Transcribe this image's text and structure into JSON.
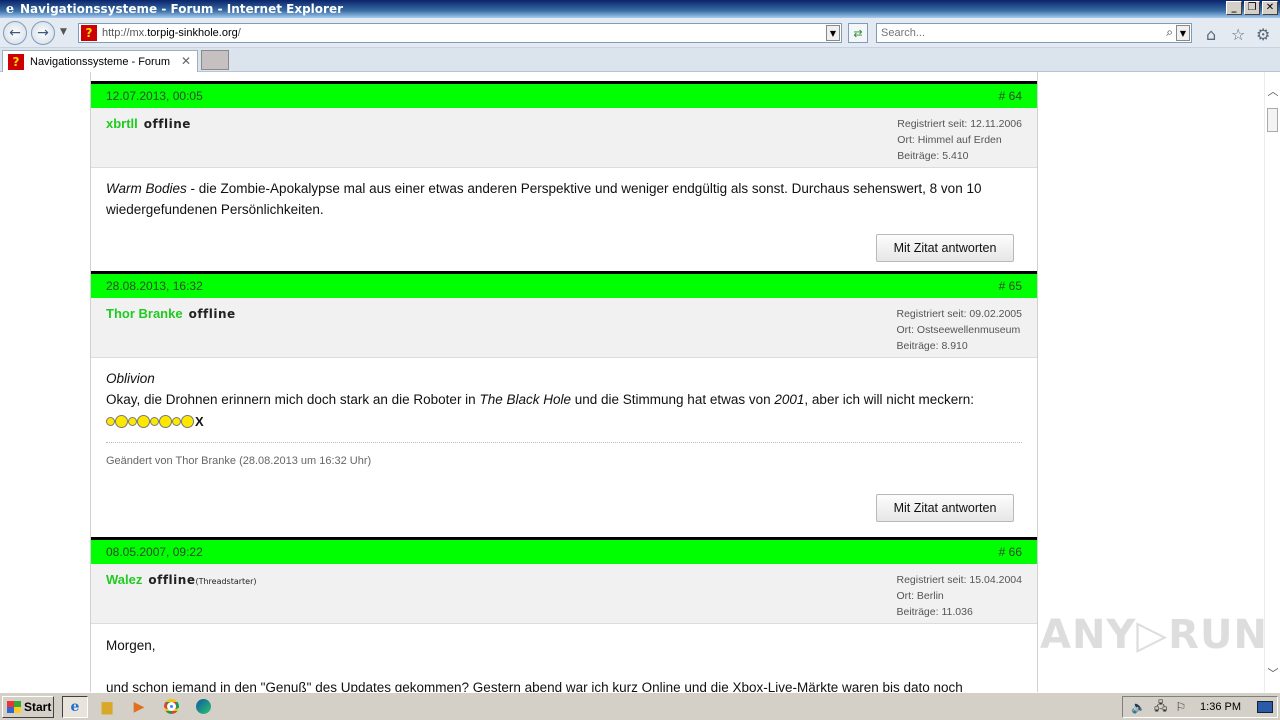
{
  "window": {
    "title": "Navigationssysteme - Forum - Internet Explorer",
    "minimize": "_",
    "restore": "❐",
    "close": "✕"
  },
  "address": {
    "url_prefix": "http://mx.",
    "url_domain": "torpig-sinkhole.org",
    "url_suffix": "/"
  },
  "search": {
    "placeholder": "Search..."
  },
  "tab": {
    "label": "Navigationssysteme - Forum",
    "close": "✕"
  },
  "posts": [
    {
      "date": "12.07.2013, 00:05",
      "number": "# 64",
      "username": "xbrtll",
      "status": "offline",
      "status_extra": "",
      "registered": "Registriert seit: 12.11.2006",
      "location": "Ort: Himmel auf Erden",
      "posts_count": "Beiträge: 5.410",
      "body_italic": "Warm Bodies",
      "body_text": " - die Zombie-Apokalypse mal aus einer etwas anderen Perspektive und weniger endgültig als sonst. Durchaus sehenswert, 8 von 10 wiedergefundenen Persönlichkeiten.",
      "reply_label": "Mit Zitat antworten"
    },
    {
      "date": "28.08.2013, 16:32",
      "number": "# 65",
      "username": "Thor Branke",
      "status": "offline",
      "status_extra": "",
      "registered": "Registriert seit: 09.02.2005",
      "location": "Ort: Ostseewellenmuseum",
      "posts_count": "Beiträge: 8.910",
      "title_italic": "Oblivion",
      "line_a": "Okay, die Drohnen erinnern mich doch stark an die Roboter in ",
      "line_b_italic": "The Black Hole",
      "line_c": " und die Stimmung hat etwas von ",
      "line_d_italic": "2001",
      "line_e": ", aber ich will nicht meckern:",
      "smilies_end": "X",
      "edited": "Geändert von Thor Branke (28.08.2013 um 16:32 Uhr)",
      "reply_label": "Mit Zitat antworten"
    },
    {
      "date": "08.05.2007, 09:22",
      "number": "# 66",
      "username": "Walez",
      "status": "offline",
      "status_extra": "(Threadstarter)",
      "registered": "Registriert seit: 15.04.2004",
      "location": "Ort: Berlin",
      "posts_count": "Beiträge: 11.036",
      "greeting": "Morgen,",
      "body_text": "und schon jemand in den \"Genuß\" des Updates gekommen? Gestern abend war ich kurz Online und die Xbox-Live-Märkte waren bis dato noch"
    }
  ],
  "watermark": "ANY▷RUN",
  "taskbar": {
    "start_label": "Start",
    "clock": "1:36 PM"
  },
  "colors": {
    "post_header": "#00ff00",
    "username": "#1ecb1e"
  }
}
